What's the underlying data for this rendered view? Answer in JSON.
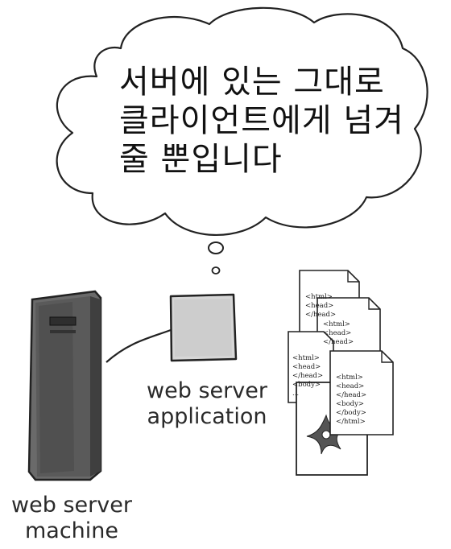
{
  "thought_bubble": {
    "lines": [
      "서버에 있는 그대로",
      "클라이언트에게 넘겨",
      "줄 뿐입니다"
    ]
  },
  "labels": {
    "application": [
      "web server",
      "application"
    ],
    "machine": [
      "web server",
      "machine"
    ]
  },
  "documents": {
    "doc1": [
      "<html>",
      "<head>",
      "</head>"
    ],
    "doc2": [
      "<html>",
      "<head>",
      "</head>"
    ],
    "doc3": [
      "<html>",
      "<head>",
      "</head>",
      "",
      "<body>",
      "",
      "..."
    ],
    "doc4": [
      "<html>",
      "<head>",
      "</head>",
      "",
      "<body>",
      "",
      "</body>",
      "</html>"
    ]
  },
  "icons": [
    "thought-bubble",
    "server-tower-icon",
    "application-box-icon",
    "html-document-icon",
    "image-file-icon"
  ],
  "colors": {
    "ink": "#222222",
    "server_dark": "#555555",
    "bubble_fill": "#ffffff"
  }
}
